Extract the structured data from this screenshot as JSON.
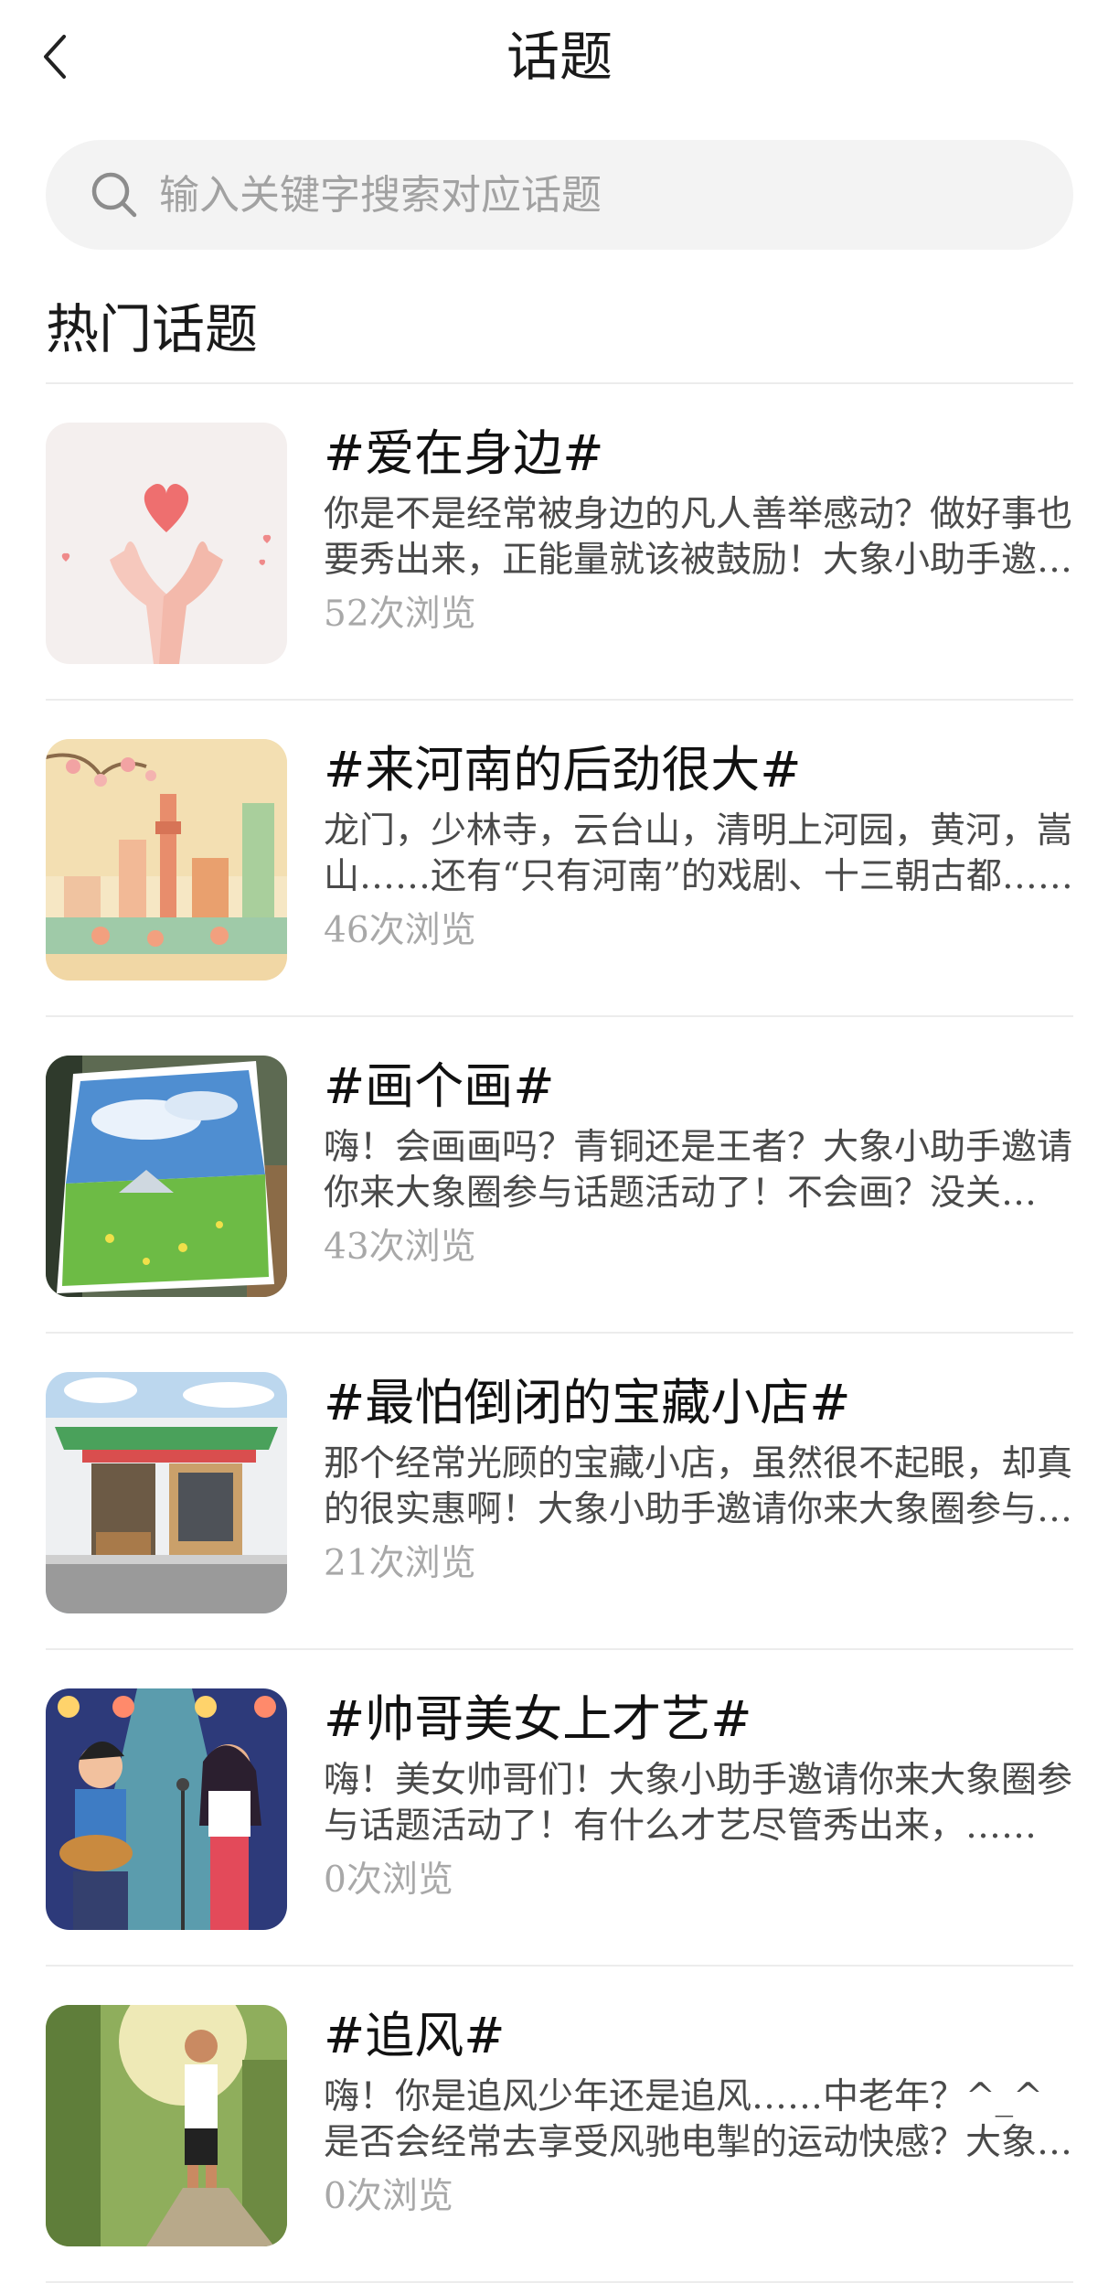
{
  "header": {
    "title": "话题",
    "back_icon": "chevron-left-icon"
  },
  "search": {
    "placeholder": "输入关键字搜索对应话题",
    "icon": "search-icon"
  },
  "section": {
    "title": "热门话题"
  },
  "topics": [
    {
      "title": "#爱在身边#",
      "desc": "你是不是经常被身边的凡人善举感动？做好事也要秀出来，正能量就该被鼓励！大象小助手邀请你来大象圈参与话题活动了！",
      "views": "52次浏览",
      "thumb": "hands-heart-image"
    },
    {
      "title": "#来河南的后劲很大#",
      "desc": "龙门，少林寺，云台山，清明上河园，黄河，嵩山……还有“只有河南”的戏剧、十三朝古都……",
      "views": "46次浏览",
      "thumb": "henan-city-illustration"
    },
    {
      "title": "#画个画#",
      "desc": "嗨！会画画吗？青铜还是王者？大象小助手邀请你来大象圈参与话题活动了！不会画？没关系……",
      "views": "43次浏览",
      "thumb": "landscape-painting-image"
    },
    {
      "title": "#最怕倒闭的宝藏小店#",
      "desc": "那个经常光顾的宝藏小店，虽然很不起眼，却真的很实惠啊！大象小助手邀请你来大象圈参与话题活动了！",
      "views": "21次浏览",
      "thumb": "small-shop-image"
    },
    {
      "title": "#帅哥美女上才艺#",
      "desc": "嗨！美女帅哥们！大象小助手邀请你来大象圈参与话题活动了！有什么才艺尽管秀出来，……",
      "views": "0次浏览",
      "thumb": "singers-illustration"
    },
    {
      "title": "#追风#",
      "desc": "嗨！你是追风少年还是追风……中老年？^_^是否会经常去享受风驰电掣的运动快感？大象小助手邀请你……",
      "views": "0次浏览",
      "thumb": "runner-image"
    }
  ],
  "colors": {
    "background": "#ffffff",
    "search_bg": "#f3f3f3",
    "divider": "#ececec",
    "text_primary": "#111111",
    "text_secondary": "#4a4a4a",
    "text_muted": "#a8a8a8"
  }
}
